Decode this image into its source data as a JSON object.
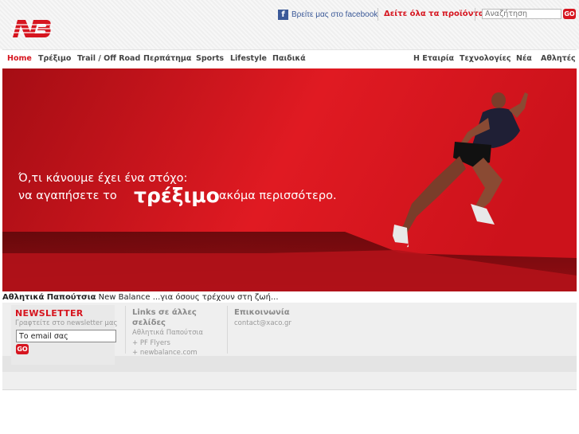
{
  "header": {
    "logo_text": "NB",
    "facebook_label": "Βρείτε μας στο facebook",
    "all_products_link": "Δείτε όλα τα προϊόντα",
    "search_placeholder": "Αναζήτηση",
    "search_go": "GO"
  },
  "nav": {
    "left": [
      "Home",
      "Τρέξιμο",
      "Trail / Off Road",
      "Περπάτημα",
      "Sports",
      "Lifestyle",
      "Παιδικά"
    ],
    "right": [
      "Η Εταιρία",
      "Τεχνολογίες",
      "Νέα",
      "Αθλητές"
    ],
    "active": "Home"
  },
  "hero": {
    "line1": "Ό,τι κάνουμε έχει ένα στόχο:",
    "line2_pre": "να αγαπήσετε το",
    "line2_big": "τρέξιμο",
    "line2_post": "ακόμα περισσότερο."
  },
  "tagline": {
    "bold": "Αθλητικά Παπούτσια",
    "rest": " New Balance ...για όσους τρέχουν στη ζωή..."
  },
  "footer": {
    "newsletter": {
      "title": "NEWSLETTER",
      "subtitle": "Γραφτείτε στο newsletter μας",
      "email_value": "Το email σας",
      "go": "GO"
    },
    "links": {
      "title": "Links σε άλλες σελίδες",
      "items": [
        "Αθλητικά Παπούτσια",
        "+ PF Flyers",
        "+ newbalance.com"
      ]
    },
    "contact": {
      "title": "Επικοινωνία",
      "email": "contact@xaco.gr"
    }
  },
  "colors": {
    "brand_red": "#d6151f",
    "facebook_blue": "#3b5998"
  }
}
